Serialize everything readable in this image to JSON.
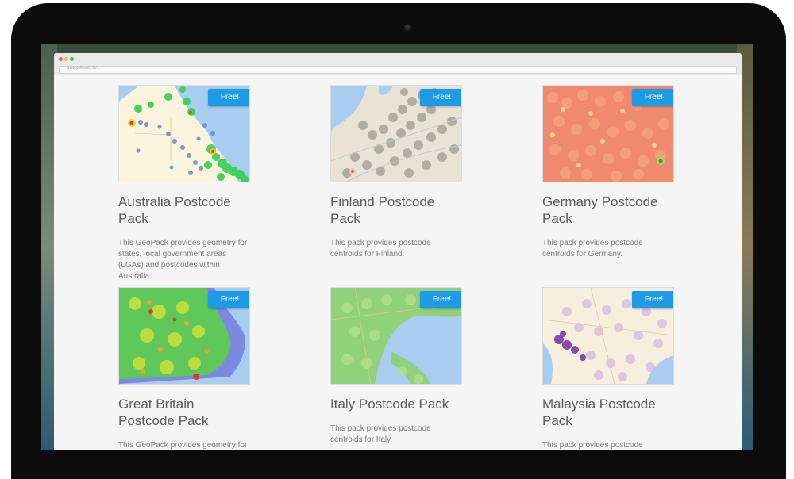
{
  "browser": {
    "url": "www.yellowfin.bi/..."
  },
  "colors": {
    "free_badge": "#1e9be6",
    "title": "#5b5b5b",
    "desc": "#7c7c7c"
  },
  "packs": [
    {
      "title": "Australia Postcode Pack",
      "badge": "Free!",
      "description": "This GeoPack provides geometry for states, local government areas (LGAs) and postcodes within Australia."
    },
    {
      "title": "Finland Postcode Pack",
      "badge": "Free!",
      "description": "This pack provides postcode centroids for Finland."
    },
    {
      "title": "Germany Postcode Pack",
      "badge": "Free!",
      "description": "This pack provides postcode centroids for Germany."
    },
    {
      "title": "Great Britain Postcode Pack",
      "badge": "Free!",
      "description": "This GeoPack provides geometry for"
    },
    {
      "title": "Italy Postcode Pack",
      "badge": "Free!",
      "description": "This pack provides postcode centroids for Italy."
    },
    {
      "title": "Malaysia Postcode Pack",
      "badge": "Free!",
      "description": "This pack provides postcode"
    }
  ]
}
